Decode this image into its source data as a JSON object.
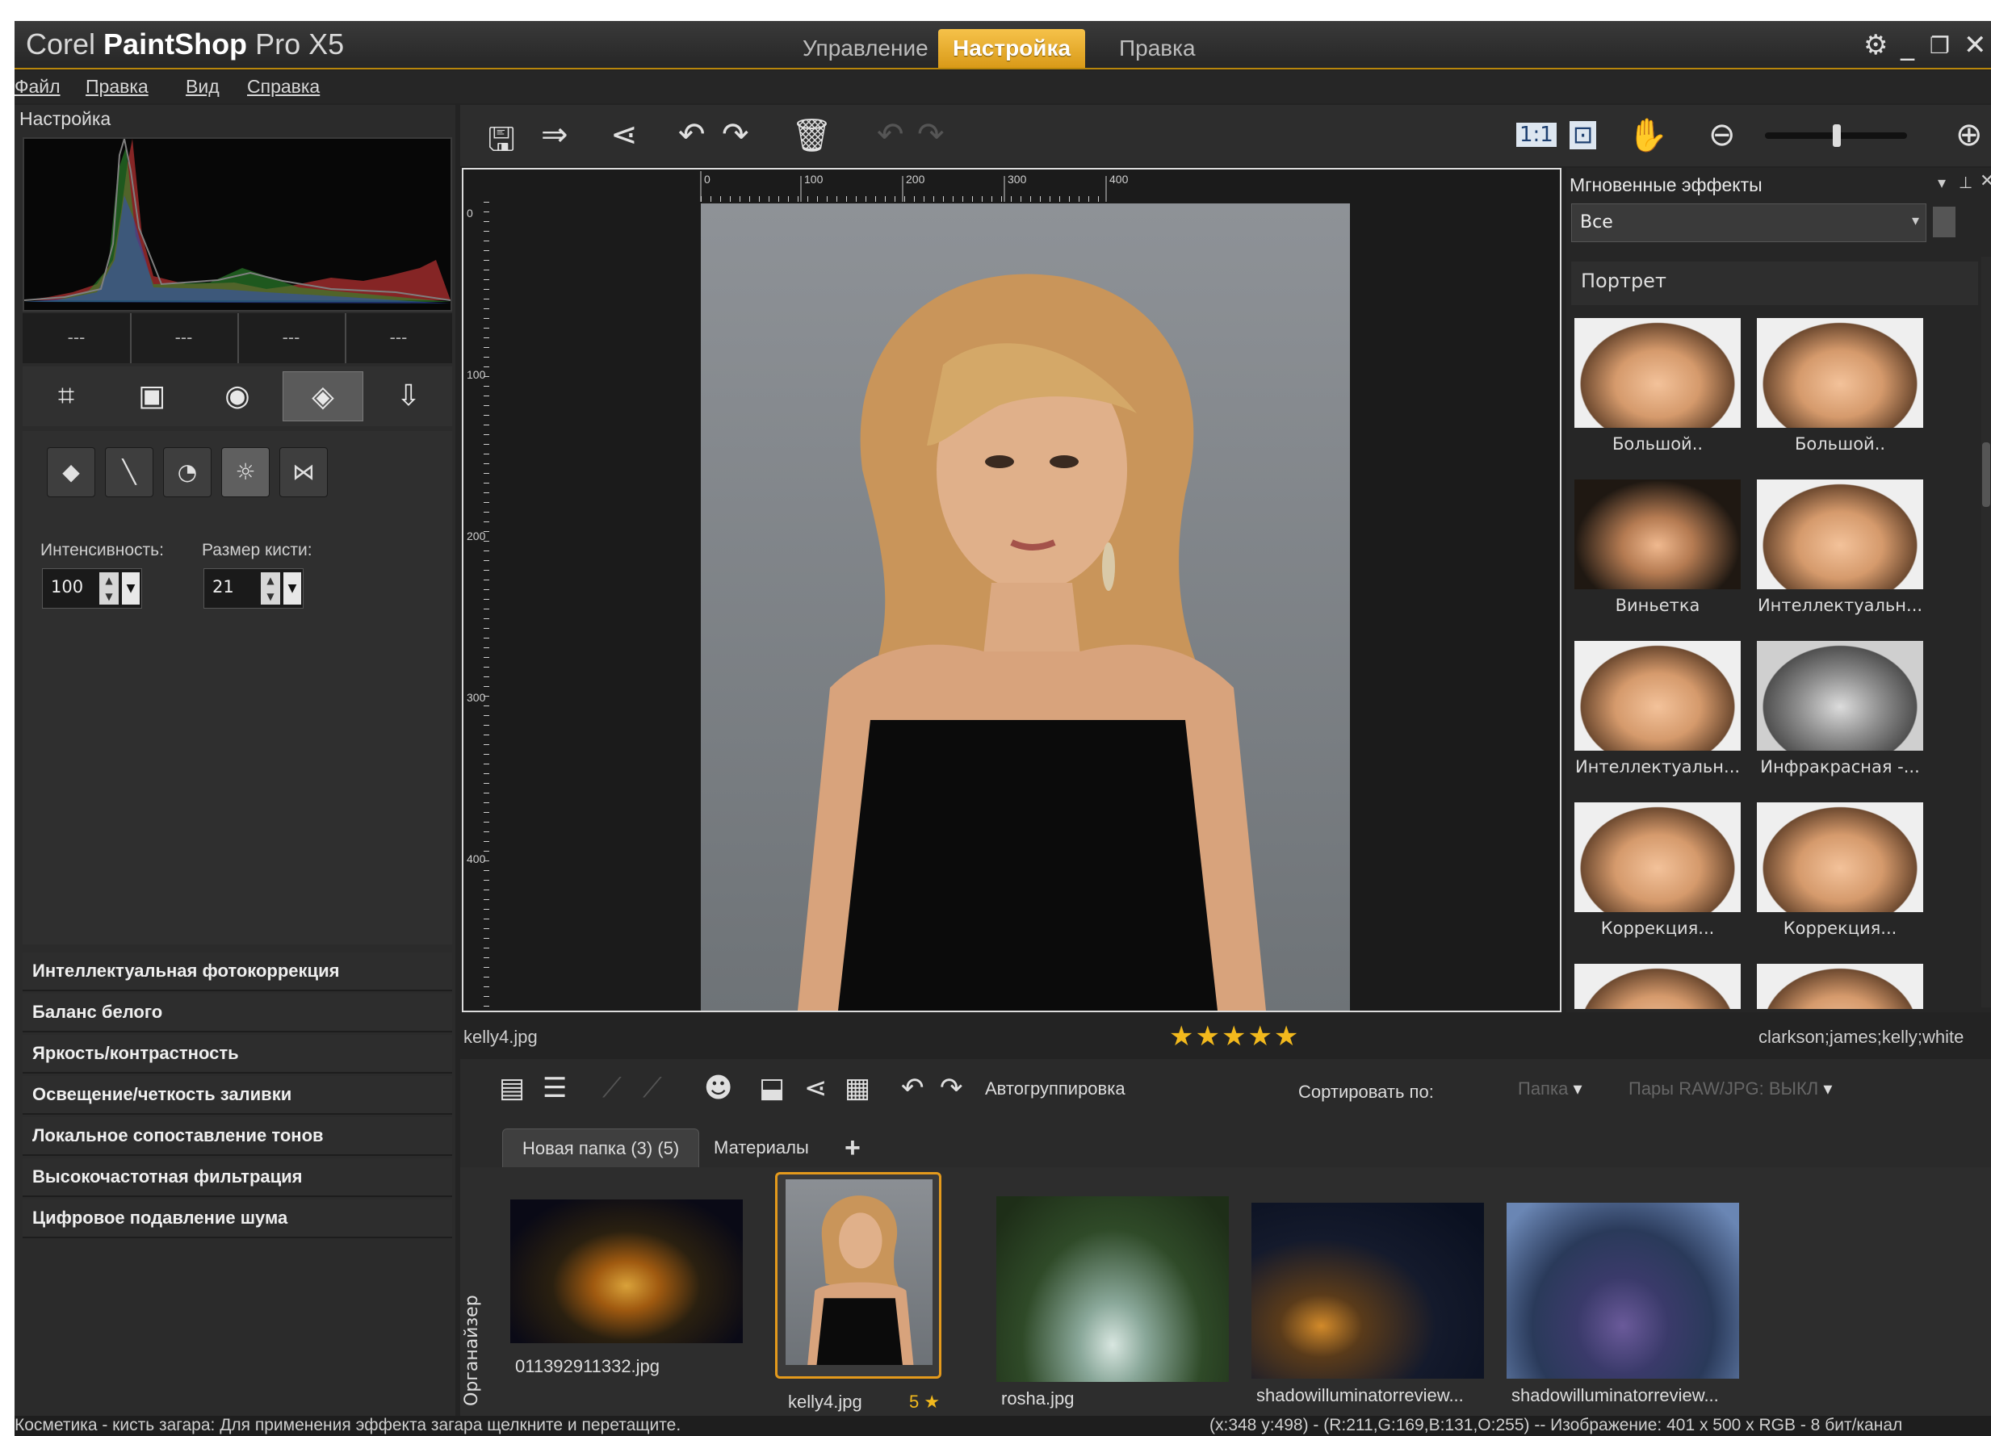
{
  "app": {
    "title_brand": "Corel",
    "title_product": "PaintShop",
    "title_version": "Pro X5",
    "mode_tabs": [
      "Управление",
      "Настройка",
      "Правка"
    ],
    "active_tab": "Настройка"
  },
  "menu": [
    "Файл",
    "Правка",
    "Вид",
    "Справка"
  ],
  "left_panel": {
    "title": "Настройка",
    "histogram_stats": [
      "---",
      "---",
      "---",
      "---"
    ],
    "tools": [
      "crop-icon",
      "straighten-icon",
      "red-eye-icon",
      "makeover-icon",
      "depth-info-icon"
    ],
    "selected_tool": "makeover-icon",
    "subtools": [
      "blemish-fixer-icon",
      "toothbrush-icon",
      "eye-drop-icon",
      "suntan-icon",
      "thinify-icon"
    ],
    "selected_subtool": "suntan-icon",
    "intensity_label": "Интенсивность:",
    "intensity_value": "100",
    "brush_size_label": "Размер кисти:",
    "brush_size_value": "21",
    "adjustments": [
      "Интеллектуальная фотокоррекция",
      "Баланс белого",
      "Яркость/контрастность",
      "Освещение/четкость заливки",
      "Локальное сопоставление тонов",
      "Высокочастотная фильтрация",
      "Цифровое подавление шума"
    ]
  },
  "toolbar": {
    "icons": [
      "save-icon",
      "save-as-icon",
      "share-icon",
      "rotate-left-icon",
      "rotate-right-icon",
      "delete-icon",
      "undo-icon",
      "redo-icon",
      "actual-size-icon",
      "fit-window-icon",
      "pan-icon",
      "zoom-out-icon",
      "zoom-in-icon"
    ]
  },
  "canvas": {
    "ruler_labels_h": [
      "0",
      "100",
      "200",
      "300",
      "400"
    ],
    "ruler_labels_v": [
      "0",
      "100",
      "200",
      "300",
      "400"
    ],
    "file_name": "kelly4.jpg",
    "rating": "★★★★★",
    "tags": "clarkson;james;kelly;white"
  },
  "effects_panel": {
    "title": "Мгновенные эффекты",
    "filter_value": "Все",
    "group": "Портрет",
    "items": [
      {
        "label": "Большой..",
        "style": "light"
      },
      {
        "label": "Большой..",
        "style": "light"
      },
      {
        "label": "Виньетка",
        "style": "dark"
      },
      {
        "label": "Интеллектуальн...",
        "style": "light"
      },
      {
        "label": "Интеллектуальн...",
        "style": "light"
      },
      {
        "label": "Инфракрасная -...",
        "style": "bw"
      },
      {
        "label": "Коррекция...",
        "style": "light"
      },
      {
        "label": "Коррекция...",
        "style": "light"
      }
    ]
  },
  "organizer": {
    "side_label": "Органайзер",
    "autogroup": "Автогруппировка",
    "sort_by": "Сортировать по:",
    "sort_value": "Папка",
    "raw_pairs": "Пары RAW/JPG: ВЫКЛ",
    "tabs": [
      "Новая папка (3) (5)",
      "Материалы"
    ],
    "add_tab": "+",
    "photos": [
      {
        "name": "011392911332.jpg",
        "rating": ""
      },
      {
        "name": "kelly4.jpg",
        "rating": "5 ★"
      },
      {
        "name": "rosha.jpg",
        "rating": ""
      },
      {
        "name": "shadowilluminatorreview...",
        "rating": ""
      },
      {
        "name": "shadowilluminatorreview...",
        "rating": ""
      }
    ]
  },
  "status": {
    "left": "Косметика - кисть загара: Для применения эффекта загара щелкните и перетащите.",
    "right": "(x:348 y:498) - (R:211,G:169,B:131,O:255) -- Изображение:  401 x 500 x RGB - 8 бит/канал"
  }
}
